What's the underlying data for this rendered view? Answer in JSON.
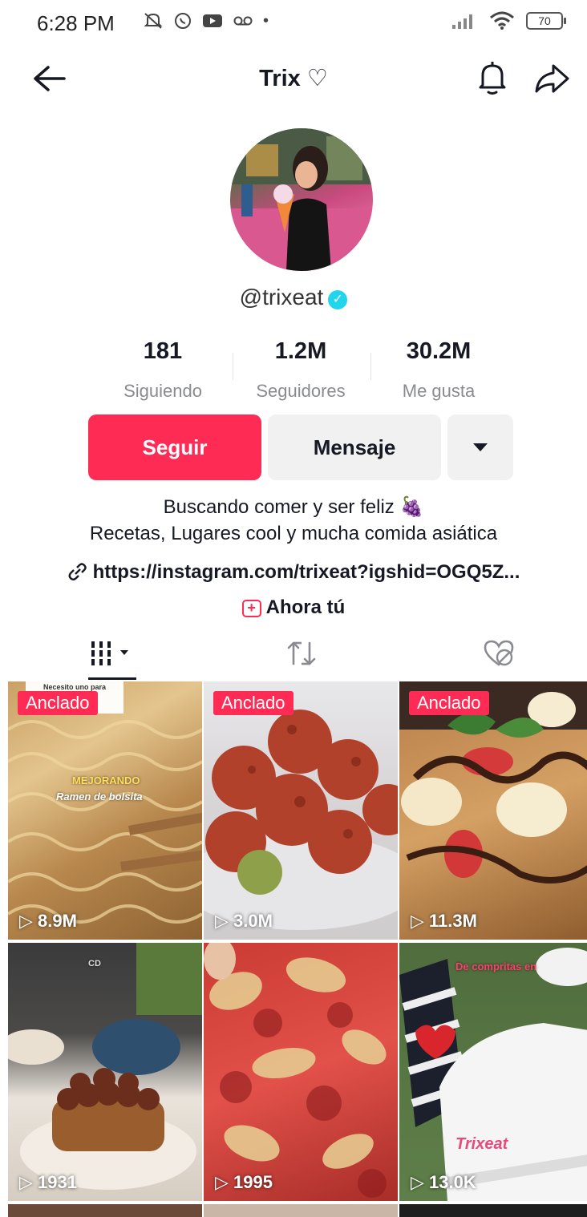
{
  "status_bar": {
    "time": "6:28 PM",
    "battery": "70"
  },
  "header": {
    "title": "Trix ♡"
  },
  "profile": {
    "handle": "@trixeat",
    "stats": [
      {
        "value": "181",
        "label": "Siguiendo"
      },
      {
        "value": "1.2M",
        "label": "Seguidores"
      },
      {
        "value": "30.2M",
        "label": "Me gusta"
      }
    ],
    "follow_label": "Seguir",
    "message_label": "Mensaje",
    "bio_line1": "Buscando comer y ser feliz 🍇",
    "bio_line2": "Recetas, Lugares cool y mucha comida asiática",
    "link": "https://instagram.com/trixeat?igshid=OGQ5Z...",
    "now_label": "Ahora tú"
  },
  "colors": {
    "accent": "#fe2c55",
    "verified": "#20d5ec"
  },
  "tabs": [
    {
      "icon": "videos-grid-icon"
    },
    {
      "icon": "repost-icon"
    },
    {
      "icon": "liked-hidden-icon"
    }
  ],
  "videos": [
    {
      "pinned": "Anclado",
      "views": "8.9M",
      "overlay_top": "Necesito uno para",
      "overlay_1": "MEJORANDO",
      "overlay_2": "Ramen de bolsita"
    },
    {
      "pinned": "Anclado",
      "views": "3.0M"
    },
    {
      "pinned": "Anclado",
      "views": "11.3M"
    },
    {
      "views": "1931",
      "overlay_1": "CD"
    },
    {
      "views": "1995"
    },
    {
      "views": "13.0K",
      "overlay_1": "De compritas en",
      "overlay_2": "Trixeat"
    }
  ]
}
